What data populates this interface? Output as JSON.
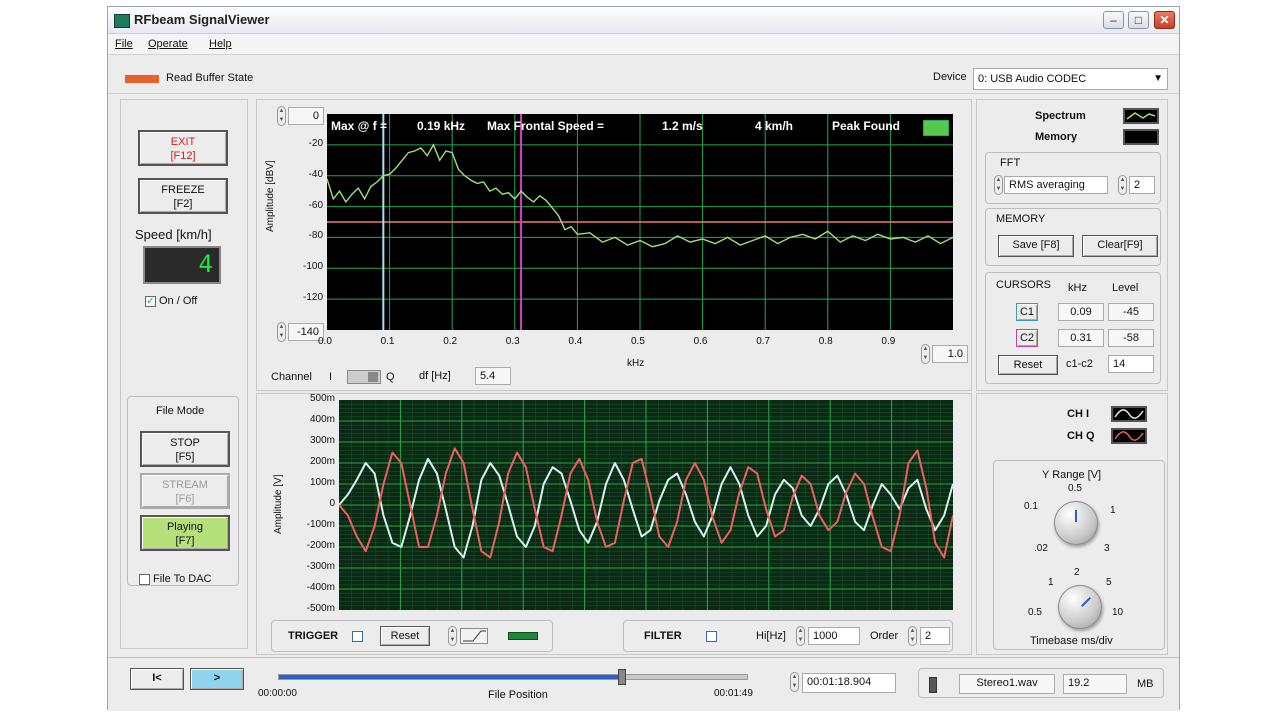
{
  "window": {
    "title": "RFbeam SignalViewer"
  },
  "menu": [
    "File",
    "Operate",
    "Help"
  ],
  "topbar": {
    "read_buffer_label": "Read Buffer State",
    "device_label": "Device",
    "device_value": "0: USB Audio CODEC"
  },
  "left": {
    "exit_l1": "EXIT",
    "exit_l2": "[F12]",
    "freeze_l1": "FREEZE",
    "freeze_l2": "[F2]",
    "speed_label": "Speed [km/h]",
    "speed_value": "4",
    "onoff_label": "On / Off",
    "file_mode_label": "File Mode",
    "stop_l1": "STOP",
    "stop_l2": "[F5]",
    "stream_l1": "STREAM",
    "stream_l2": "[F6]",
    "playing_l1": "Playing",
    "playing_l2": "[F7]",
    "file_to_dac_label": "File To DAC"
  },
  "spectrum": {
    "readout_max": "Max @ f =",
    "readout_freq": "0.19 kHz",
    "readout_speed_label": "Max Frontal Speed =",
    "readout_speed_ms": "1.2  m/s",
    "readout_speed_kmh": "4  km/h",
    "peak_label": "Peak Found",
    "ymax_value": "0",
    "ymin_value": "-140",
    "xmax_value": "1.0",
    "channel_label": "Channel",
    "channel_i": "I",
    "channel_q": "Q",
    "df_label": "df [Hz]",
    "df_value": "5.4"
  },
  "right": {
    "spectrum_label": "Spectrum",
    "memory_label": "Memory",
    "fft_label": "FFT",
    "fft_mode": "RMS averaging",
    "fft_count": "2",
    "memory_group": "MEMORY",
    "save_btn": "Save [F8]",
    "clear_btn": "Clear[F9]",
    "cursors_label": "CURSORS",
    "khz_col": "kHz",
    "level_col": "Level",
    "c1_label": "C1",
    "c1_khz": "0.09",
    "c1_level": "-45",
    "c2_label": "C2",
    "c2_khz": "0.31",
    "c2_level": "-58",
    "reset_btn": "Reset",
    "c1c2_label": "c1-c2",
    "c1c2_value": "14",
    "chi_label": "CH I",
    "chq_label": "CH Q",
    "yrange_label": "Y Range [V]",
    "yrange_ticks": [
      "0.1",
      "0.5",
      "1",
      ".02",
      "3"
    ],
    "timebase_ticks": [
      "1",
      "2",
      "5",
      "0.5",
      "10"
    ],
    "timebase_label": "Timebase ms/div"
  },
  "timeplot": {
    "trigger_label": "TRIGGER",
    "reset_btn": "Reset",
    "filter_label": "FILTER",
    "hi_label": "Hi[Hz]",
    "hi_value": "1000",
    "order_label": "Order",
    "order_value": "2"
  },
  "bottom": {
    "start_btn": "I<",
    "play_btn": ">",
    "time_start": "00:00:00",
    "file_position_label": "File Position",
    "time_end": "00:01:49",
    "current_time": "00:01:18.904",
    "file_name": "Stereo1.wav",
    "file_size": "19.2",
    "size_unit": "MB",
    "progress": 0.73
  },
  "colors": {
    "ch_i": "#d8f0f0",
    "ch_q": "#ee5f5f",
    "spectrum_trace": "#9ee07a",
    "threshold": "#e77a7a",
    "cursor1": "#a9e3f2",
    "cursor2": "#d23ec8",
    "grid": "#2aa64a",
    "read_buffer": "#e8602a",
    "peak_lamp": "#57c94a"
  },
  "chart_data": [
    {
      "type": "line",
      "xlabel": "kHz",
      "ylabel": "Amplitude [dBV]",
      "xlim": [
        0,
        1.0
      ],
      "ylim": [
        -140,
        0
      ],
      "x_ticks": [
        "0.0",
        "0.1",
        "0.2",
        "0.3",
        "0.4",
        "0.5",
        "0.6",
        "0.7",
        "0.8",
        "0.9"
      ],
      "y_ticks": [
        "-20",
        "-40",
        "-60",
        "-80",
        "-100",
        "-120"
      ],
      "threshold": -70,
      "cursors": [
        0.09,
        0.31
      ],
      "series": [
        {
          "x": [
            0.0,
            0.01,
            0.02,
            0.03,
            0.04,
            0.05,
            0.06,
            0.07,
            0.08,
            0.09,
            0.1,
            0.11,
            0.12,
            0.13,
            0.14,
            0.15,
            0.16,
            0.17,
            0.18,
            0.19,
            0.2,
            0.21,
            0.22,
            0.23,
            0.24,
            0.25,
            0.26,
            0.27,
            0.28,
            0.29,
            0.3,
            0.31,
            0.32,
            0.33,
            0.34,
            0.35,
            0.36,
            0.37,
            0.38,
            0.39,
            0.4,
            0.42,
            0.44,
            0.46,
            0.48,
            0.5,
            0.52,
            0.54,
            0.56,
            0.58,
            0.6,
            0.62,
            0.64,
            0.66,
            0.68,
            0.7,
            0.72,
            0.74,
            0.76,
            0.78,
            0.8,
            0.82,
            0.84,
            0.86,
            0.88,
            0.9,
            0.92,
            0.94,
            0.96,
            0.98,
            1.0
          ],
          "values": [
            -42,
            -55,
            -50,
            -57,
            -52,
            -48,
            -55,
            -47,
            -44,
            -40,
            -39,
            -35,
            -30,
            -25,
            -24,
            -22,
            -27,
            -20,
            -30,
            -24,
            -25,
            -36,
            -40,
            -43,
            -45,
            -44,
            -50,
            -48,
            -52,
            -51,
            -55,
            -50,
            -54,
            -57,
            -53,
            -56,
            -61,
            -66,
            -75,
            -73,
            -78,
            -77,
            -83,
            -80,
            -85,
            -82,
            -86,
            -84,
            -79,
            -83,
            -81,
            -84,
            -80,
            -85,
            -82,
            -79,
            -84,
            -80,
            -78,
            -81,
            -76,
            -83,
            -79,
            -82,
            -78,
            -81,
            -80,
            -83,
            -79,
            -84,
            -80
          ]
        }
      ]
    },
    {
      "type": "line",
      "ylabel": "Amplitude [V]",
      "ylim": [
        -0.5,
        0.5
      ],
      "y_ticks": [
        "500m",
        "400m",
        "300m",
        "200m",
        "100m",
        "0",
        "-100m",
        "-200m",
        "-300m",
        "-400m",
        "-500m"
      ],
      "series": [
        {
          "name": "CH I",
          "values": [
            0,
            0.05,
            0.12,
            0.2,
            0.15,
            -0.05,
            -0.18,
            -0.2,
            -0.05,
            0.12,
            0.22,
            0.15,
            -0.02,
            -0.2,
            -0.25,
            -0.1,
            0.12,
            0.2,
            0.14,
            0.0,
            -0.15,
            -0.2,
            -0.1,
            0.1,
            0.18,
            0.15,
            0.02,
            -0.12,
            -0.18,
            -0.08,
            0.1,
            0.2,
            0.12,
            -0.02,
            -0.15,
            -0.12,
            0.02,
            0.12,
            0.15,
            0.05,
            -0.08,
            -0.15,
            -0.05,
            0.1,
            0.18,
            0.1,
            -0.05,
            -0.15,
            -0.1,
            0.05,
            0.12,
            0.08,
            -0.05,
            -0.1,
            -0.02,
            0.1,
            0.14,
            0.05,
            -0.08,
            -0.12,
            0.0,
            0.1,
            0.05,
            -0.02,
            0.08,
            0.12,
            -0.02,
            -0.12,
            -0.05,
            0.1
          ]
        },
        {
          "name": "CH Q",
          "values": [
            0,
            -0.05,
            -0.15,
            -0.22,
            -0.1,
            0.1,
            0.25,
            0.2,
            0.0,
            -0.2,
            -0.2,
            -0.05,
            0.15,
            0.27,
            0.2,
            -0.02,
            -0.22,
            -0.25,
            -0.08,
            0.15,
            0.25,
            0.18,
            -0.02,
            -0.2,
            -0.22,
            -0.05,
            0.15,
            0.22,
            0.12,
            -0.08,
            -0.2,
            -0.18,
            0.02,
            0.2,
            0.22,
            0.05,
            -0.15,
            -0.2,
            -0.08,
            0.12,
            0.2,
            0.12,
            -0.06,
            -0.18,
            -0.12,
            0.06,
            0.18,
            0.15,
            -0.02,
            -0.15,
            -0.12,
            0.04,
            0.14,
            0.1,
            -0.05,
            -0.12,
            -0.08,
            0.06,
            0.15,
            0.1,
            -0.06,
            -0.2,
            -0.22,
            -0.05,
            0.2,
            0.26,
            0.08,
            -0.18,
            -0.25,
            -0.05
          ]
        }
      ]
    }
  ]
}
